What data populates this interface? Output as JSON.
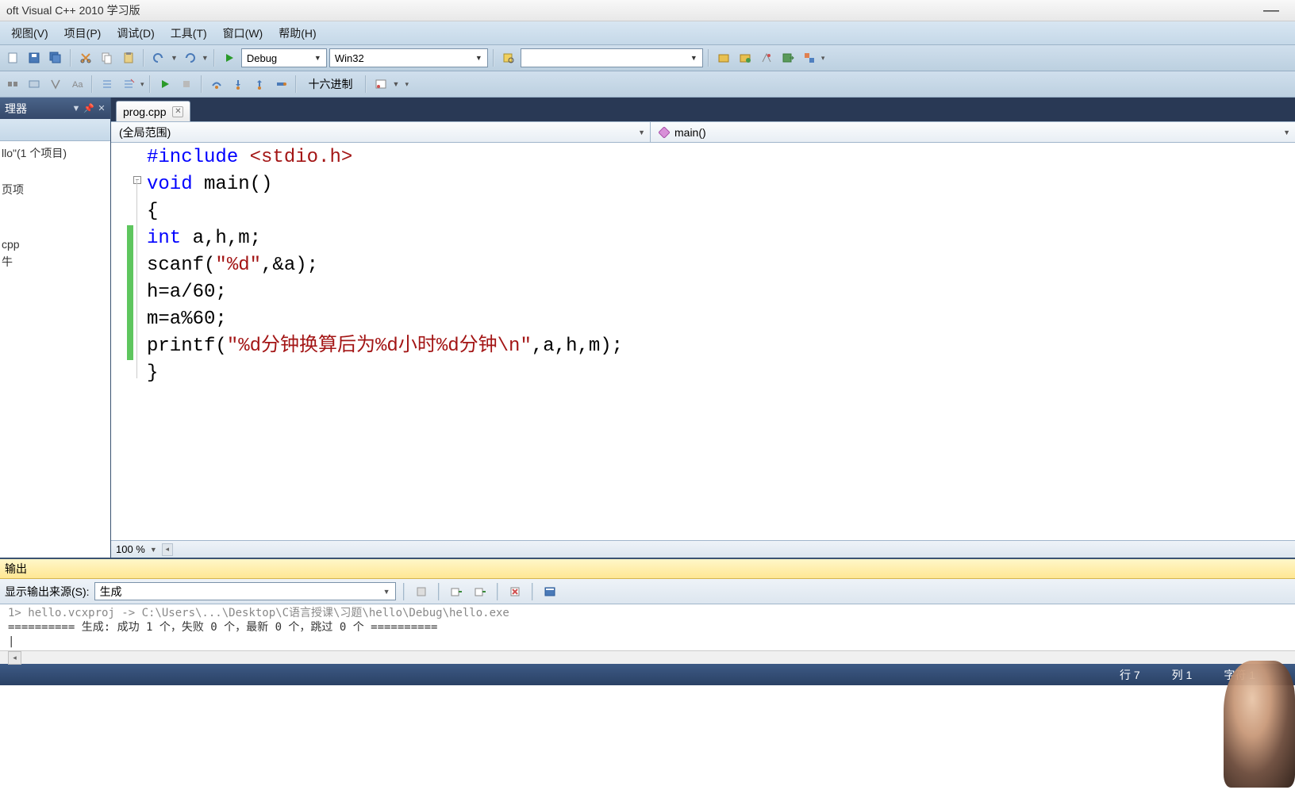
{
  "title": "oft Visual C++ 2010 学习版",
  "menu": {
    "items": [
      "视图(V)",
      "项目(P)",
      "调试(D)",
      "工具(T)",
      "窗口(W)",
      "帮助(H)"
    ]
  },
  "toolbar1": {
    "config_dd": "Debug",
    "platform_dd": "Win32",
    "search_value": ""
  },
  "toolbar2": {
    "hex_label": "十六进制"
  },
  "side_panel": {
    "title": "理器",
    "tree_root": "llo\"(1 个项目)",
    "tree_item1": "页项",
    "tree_item2": "cpp",
    "tree_item3": "牛"
  },
  "editor": {
    "tab_name": "prog.cpp",
    "scope_left": "(全局范围)",
    "scope_right": "main()",
    "zoom": "100 %",
    "code": {
      "l1_pre": "#include",
      "l1_inc": " <stdio.h>",
      "l2_kw": "void",
      "l2_rest": " main()",
      "l3": "{",
      "l4_kw": "int",
      "l4_rest": " a,h,m;",
      "l5_a": "scanf(",
      "l5_str": "\"%d\"",
      "l5_b": ",&a);",
      "l6": "h=a/60;",
      "l7": "m=a%60;",
      "l8_a": "printf(",
      "l8_str": "\"%d分钟换算后为%d小时%d分钟\\n\"",
      "l8_b": ",a,h,m);",
      "l9": "}"
    }
  },
  "output": {
    "title": "输出",
    "source_label": "显示输出来源(S):",
    "source_value": "生成",
    "line1": "========== 生成: 成功 1 个，失败 0 个，最新 0 个，跳过 0 个 =========="
  },
  "status": {
    "line": "行 7",
    "col": "列 1",
    "char": "字符 1"
  }
}
